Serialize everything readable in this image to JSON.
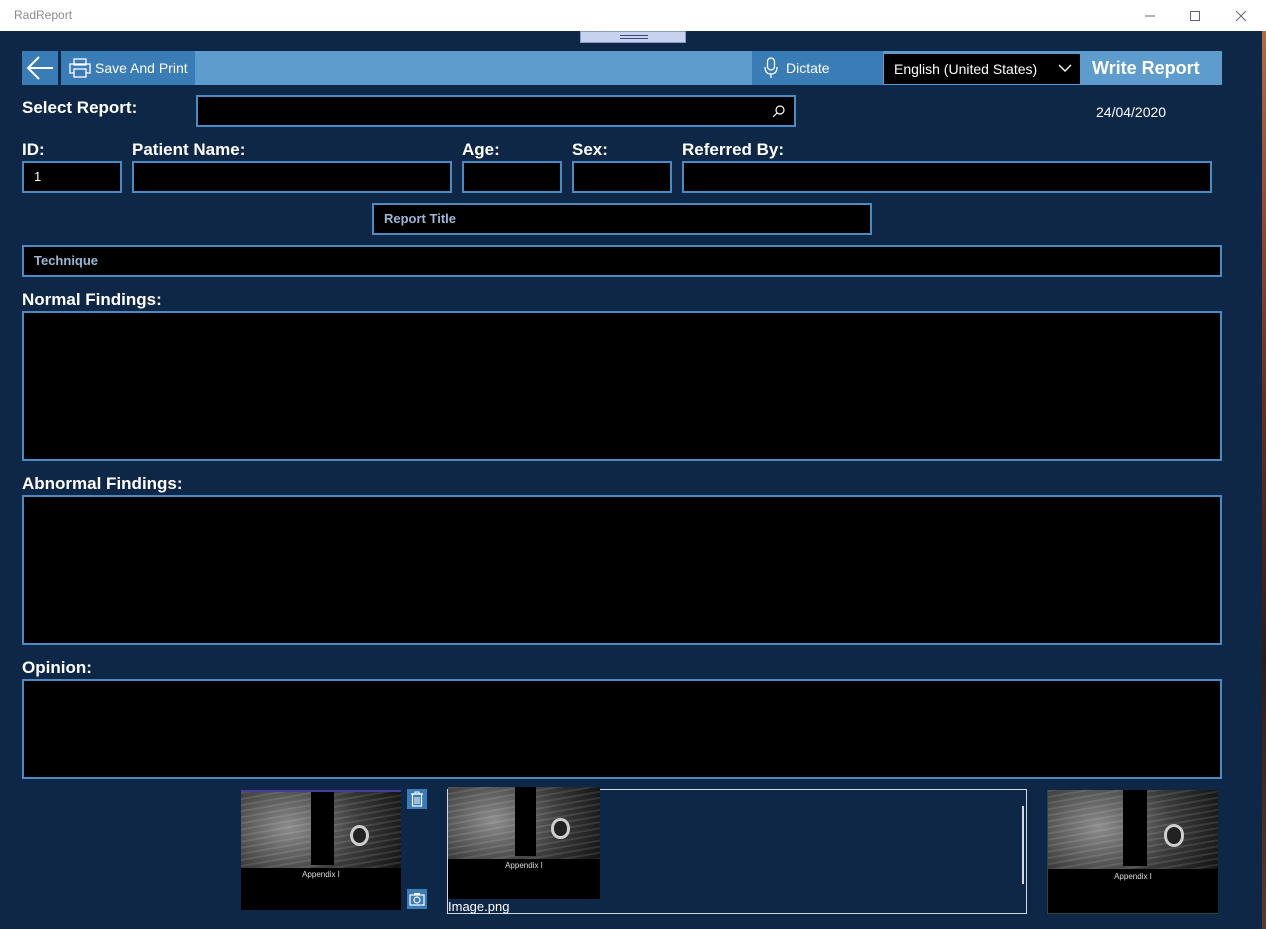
{
  "window": {
    "title": "RadReport"
  },
  "toolbar": {
    "save_print": "Save And Print",
    "dictate": "Dictate",
    "language": "English (United States)",
    "write_report": "Write Report"
  },
  "form": {
    "select_report_label": "Select Report:",
    "select_report_value": "",
    "date": "24/04/2020",
    "id_label": "ID:",
    "id_value": "1",
    "patient_name_label": "Patient Name:",
    "patient_name_value": "",
    "age_label": "Age:",
    "age_value": "",
    "sex_label": "Sex:",
    "sex_value": "",
    "referred_by_label": "Referred By:",
    "referred_by_value": "",
    "report_title_placeholder": "Report Title",
    "technique_placeholder": "Technique",
    "normal_findings_label": "Normal Findings:",
    "abnormal_findings_label": "Abnormal Findings:",
    "opinion_label": "Opinion:"
  },
  "images": {
    "caption": "Appendix I",
    "gallery_file": "Image.png"
  },
  "colors": {
    "accent": "#3a7cb5",
    "toolbar": "#5d9ccd",
    "background": "#0e2747",
    "border": "#4b8bc4"
  }
}
